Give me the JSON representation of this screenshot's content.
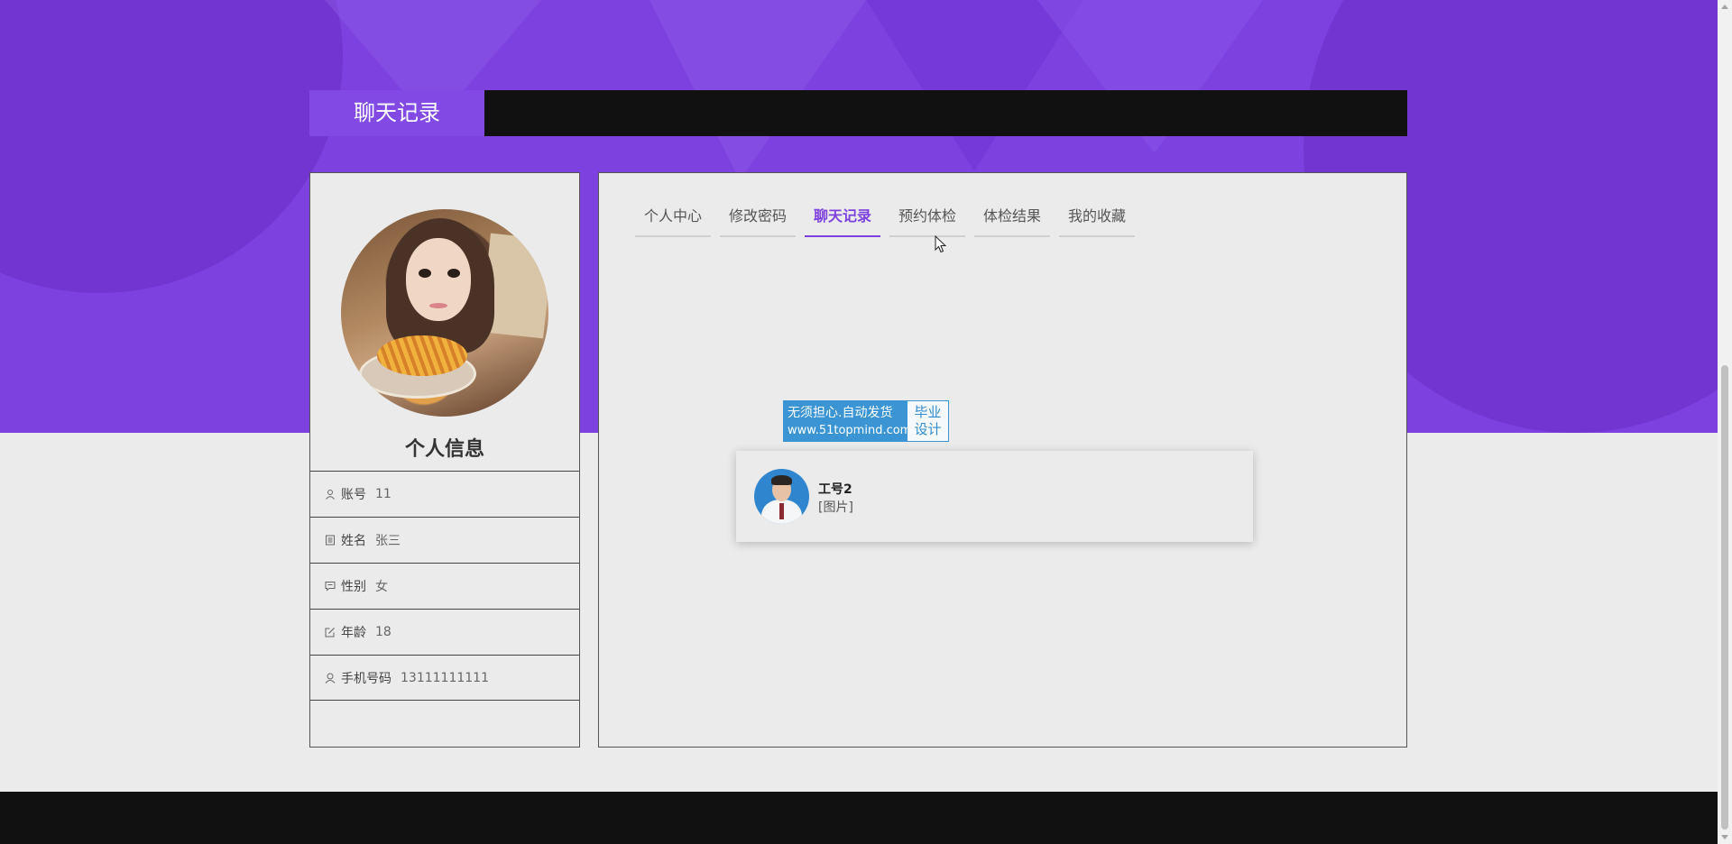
{
  "page": {
    "title": "聊天记录"
  },
  "profile": {
    "heading": "个人信息",
    "fields": [
      {
        "label": "账号",
        "value": "11",
        "icon": "user-icon"
      },
      {
        "label": "姓名",
        "value": "张三",
        "icon": "id-card-icon"
      },
      {
        "label": "性别",
        "value": "女",
        "icon": "message-icon"
      },
      {
        "label": "年龄",
        "value": "18",
        "icon": "edit-icon"
      },
      {
        "label": "手机号码",
        "value": "13111111111",
        "icon": "person-icon"
      }
    ]
  },
  "tabs": [
    {
      "label": "个人中心",
      "active": false
    },
    {
      "label": "修改密码",
      "active": false
    },
    {
      "label": "聊天记录",
      "active": true
    },
    {
      "label": "预约体检",
      "active": false
    },
    {
      "label": "体检结果",
      "active": false
    },
    {
      "label": "我的收藏",
      "active": false
    }
  ],
  "watermark": {
    "line1": "无须担心.自动发货",
    "line2": "www.51topmind.com",
    "side1": "毕业",
    "side2": "设计"
  },
  "chats": [
    {
      "name": "工号2",
      "message": "[图片]"
    }
  ],
  "colors": {
    "accent": "#7d41e0",
    "hero": "#7d41e0",
    "dark": "#111111",
    "background": "#ebebeb"
  }
}
